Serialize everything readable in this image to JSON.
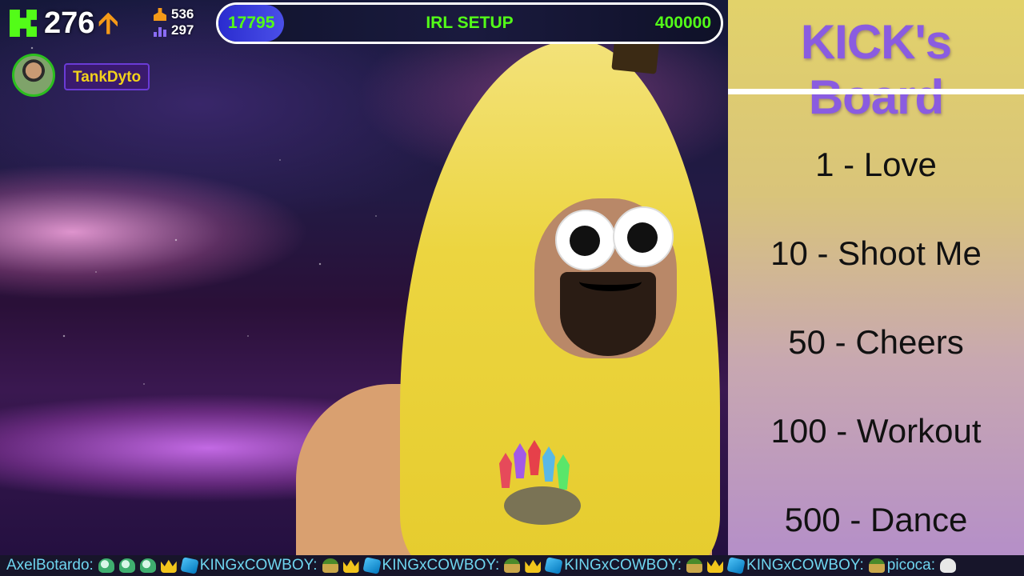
{
  "overlay": {
    "kick_count": "276",
    "followers": "536",
    "viewers": "297",
    "icons": {
      "logo": "kick-logo-icon",
      "trend": "up-arrow-icon",
      "followers": "person-icon",
      "viewers": "bar-chart-icon"
    },
    "colors": {
      "kick_green": "#53fc18",
      "accent_orange": "#f59a18",
      "board_title": "#8a5ce0"
    }
  },
  "goal": {
    "current": "17795",
    "title": "IRL SETUP",
    "target": "400000",
    "progress_fraction": 0.044
  },
  "latest_follower": {
    "username": "TankDyto"
  },
  "board": {
    "title": "KICK's Board",
    "items": [
      "1 - Love",
      "10 - Shoot Me",
      "50 - Cheers",
      "100 - Workout",
      "500 - Dance"
    ]
  },
  "chat_ticker": {
    "user1": "AxelBotardo:",
    "user2": "KINGxCOWBOY:",
    "user3": "KINGxCOWBOY:",
    "user4": "KINGxCOWBOY:",
    "user5": "KINGxCOWBOY:",
    "user6": "picoca:",
    "emote_names": [
      "ghost-emote-icon",
      "crown-emote-icon",
      "cube-emote-icon",
      "cowboy-hat-emote-icon",
      "skull-emote-icon"
    ]
  }
}
